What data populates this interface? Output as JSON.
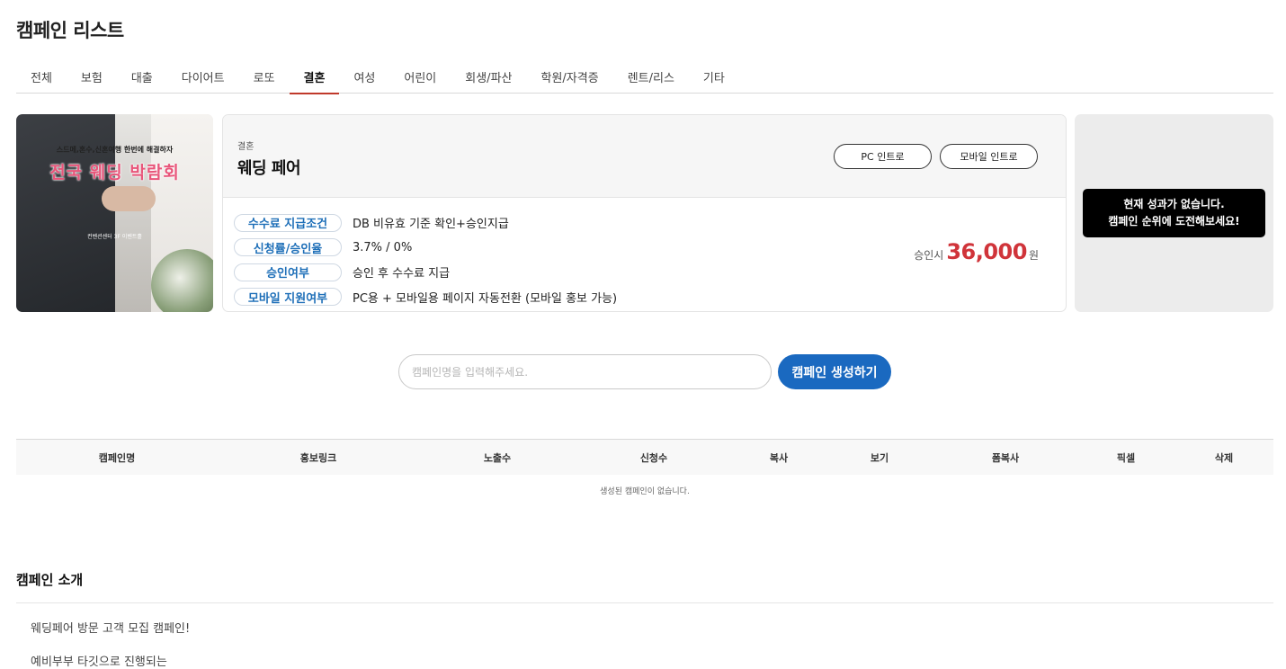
{
  "page": {
    "title": "캠페인 리스트"
  },
  "tabs": [
    {
      "label": "전체",
      "active": false
    },
    {
      "label": "보험",
      "active": false
    },
    {
      "label": "대출",
      "active": false
    },
    {
      "label": "다이어트",
      "active": false
    },
    {
      "label": "로또",
      "active": false
    },
    {
      "label": "결혼",
      "active": true
    },
    {
      "label": "여성",
      "active": false
    },
    {
      "label": "어린이",
      "active": false
    },
    {
      "label": "회생/파산",
      "active": false
    },
    {
      "label": "학원/자격증",
      "active": false
    },
    {
      "label": "렌트/리스",
      "active": false
    },
    {
      "label": "기타",
      "active": false
    }
  ],
  "card": {
    "thumbnail": {
      "caption_top": "스드메,혼수,신혼여행 한번에 해결하자",
      "caption_main": "전국 웨딩 박람회",
      "caption_bottom": "컨벤션센터 3F 이벤트홀"
    },
    "category": "결혼",
    "name": "웨딩 페어",
    "pc_intro": "PC 인트로",
    "mobile_intro": "모바일 인트로",
    "rows": [
      {
        "label": "수수료 지급조건",
        "value": "DB 비유효 기준 확인+승인지급"
      },
      {
        "label": "신청률/승인율",
        "value": "3.7% / 0%"
      },
      {
        "label": "승인여부",
        "value": "승인 후 수수료 지급"
      },
      {
        "label": "모바일 지원여부",
        "value": "PC용 + 모바일용 페이지 자동전환 (모바일 홍보 가능)"
      }
    ],
    "price_prefix": "승인시",
    "price_amount": "36,000",
    "price_suffix": "원"
  },
  "performance": {
    "line1": "현재 성과가 없습니다.",
    "line2": "캠페인 순위에 도전해보세요!"
  },
  "create": {
    "placeholder": "캠페인명을 입력해주세요.",
    "button": "캠페인 생성하기"
  },
  "table": {
    "headers": [
      "캠페인명",
      "홍보링크",
      "노출수",
      "신청수",
      "복사",
      "보기",
      "폼복사",
      "픽셀",
      "삭제"
    ],
    "empty": "생성된 캠페인이 없습니다."
  },
  "intro": {
    "title": "캠페인 소개",
    "lines": [
      "웨딩페어 방문 고객 모집 캠페인!",
      "예비부부 타깃으로 진행되는"
    ]
  },
  "colors": {
    "accent_tab": "#c0392b",
    "primary_button": "#1a69c0",
    "price": "#d0343a",
    "label_text": "#1e6fb8"
  }
}
